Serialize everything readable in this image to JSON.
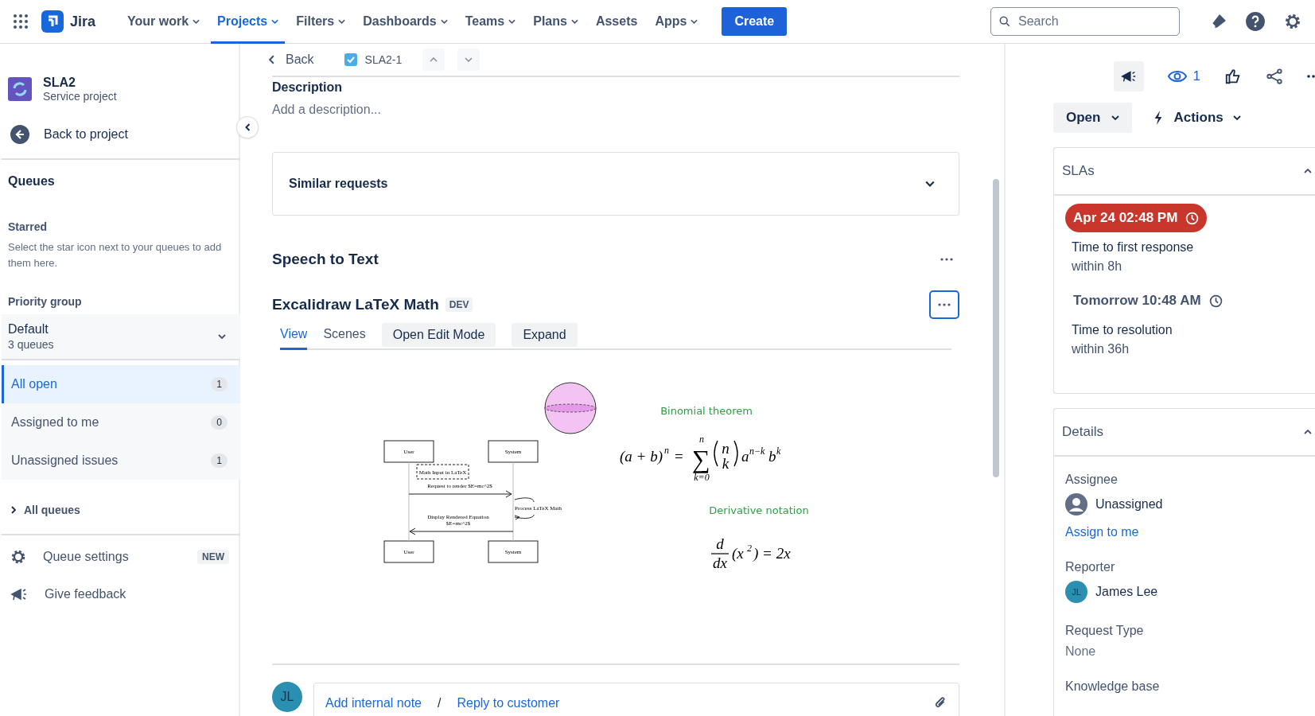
{
  "nav": {
    "logo": "Jira",
    "items": [
      {
        "label": "Your work",
        "dropdown": true,
        "selected": false
      },
      {
        "label": "Projects",
        "dropdown": true,
        "selected": true
      },
      {
        "label": "Filters",
        "dropdown": true,
        "selected": false
      },
      {
        "label": "Dashboards",
        "dropdown": true,
        "selected": false
      },
      {
        "label": "Teams",
        "dropdown": true,
        "selected": false
      },
      {
        "label": "Plans",
        "dropdown": true,
        "selected": false
      },
      {
        "label": "Assets",
        "dropdown": false,
        "selected": false
      },
      {
        "label": "Apps",
        "dropdown": true,
        "selected": false
      }
    ],
    "create": "Create",
    "search": {
      "placeholder": "Search"
    }
  },
  "sidebar": {
    "project": {
      "name": "SLA2",
      "type": "Service project"
    },
    "back": "Back to project",
    "queues_title": "Queues",
    "starred_title": "Starred",
    "starred_hint": "Select the star icon next to your queues to add them here.",
    "priority_title": "Priority group",
    "group": {
      "name": "Default",
      "count": "3 queues"
    },
    "queues": [
      {
        "label": "All open",
        "count": "1",
        "selected": true
      },
      {
        "label": "Assigned to me",
        "count": "0",
        "selected": false
      },
      {
        "label": "Unassigned issues",
        "count": "1",
        "selected": false
      }
    ],
    "all_queues": "All queues",
    "footer": [
      {
        "label": "Queue settings",
        "badge": "NEW",
        "kind": "settings"
      },
      {
        "label": "Give feedback",
        "kind": "feedback"
      }
    ]
  },
  "issue_bar": {
    "back": "Back",
    "key": "SLA2-1"
  },
  "main": {
    "description_title": "Description",
    "description_placeholder": "Add a description...",
    "similar": "Similar requests",
    "speech": "Speech to Text",
    "app": {
      "title": "Excalidraw LaTeX Math",
      "badge": "DEV",
      "tabs": [
        {
          "label": "View",
          "selected": true
        },
        {
          "label": "Scenes",
          "selected": false
        }
      ],
      "buttons": [
        "Open Edit Mode",
        "Expand"
      ]
    },
    "drawing": {
      "actors_top": [
        "User",
        "System"
      ],
      "actors_bottom": [
        "User",
        "System"
      ],
      "note": "Math Input in LaTeX",
      "request": "Request to render $E=mc^2$",
      "process": "Process LaTeX Math",
      "reply": [
        "Display Rendered Equation",
        "$E=mc^2$"
      ],
      "binomial_caption": "Binomial theorem",
      "binomial": {
        "lhs": "(a + b)",
        "lhs_exp": "n",
        "eq": "=",
        "sum": "∑",
        "sum_top": "n",
        "sum_bottom": "k=0",
        "choose_top": "n",
        "choose_bottom": "k",
        "a": "a",
        "a_exp": "n−k",
        "b": "b",
        "b_exp": "k"
      },
      "derivative_caption": "Derivative notation",
      "derivative": {
        "num": "d",
        "den": "dx",
        "body": "(x",
        "exp": "2",
        "rest": ") = 2x"
      }
    },
    "comment": {
      "avatar": "JL",
      "links": [
        "Add internal note",
        "Reply to customer"
      ],
      "separator": "/"
    }
  },
  "right": {
    "watchers": "1",
    "status": "Open",
    "actions": "Actions",
    "slas": {
      "title": "SLAs",
      "items": [
        {
          "time": "Apr 24 02:48 PM",
          "breached": true,
          "name": "Time to first response",
          "goal": "within 8h"
        },
        {
          "time": "Tomorrow 10:48 AM",
          "breached": false,
          "name": "Time to resolution",
          "goal": "within 36h"
        }
      ]
    },
    "details": {
      "title": "Details",
      "fields": [
        {
          "label": "Assignee",
          "kind": "person",
          "value": "Unassigned",
          "link": "Assign to me"
        },
        {
          "label": "Reporter",
          "kind": "person",
          "value": "James Lee",
          "avatar": "JL"
        },
        {
          "label": "Request Type",
          "kind": "text",
          "value": "None"
        },
        {
          "label": "Knowledge base",
          "kind": "label"
        }
      ]
    }
  }
}
